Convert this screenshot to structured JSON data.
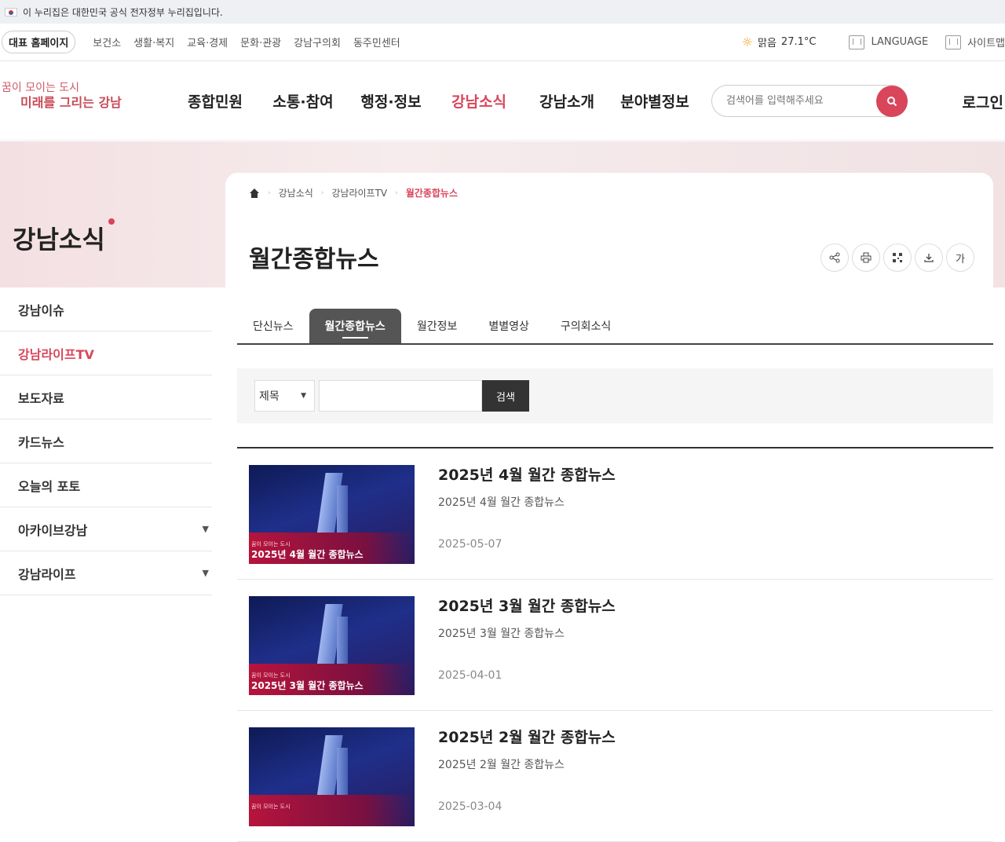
{
  "gov_banner": {
    "text": "이 누리집은 대한민국 공식 전자정부 누리집입니다."
  },
  "util": {
    "home_label": "대표 홈페이지",
    "links": [
      "보건소",
      "생활·복지",
      "교육·경제",
      "문화·관광",
      "강남구의회",
      "동주민센터"
    ],
    "weather_condition": "맑음",
    "weather_temp": "27.1°C",
    "language_label": "LANGUAGE",
    "sitemap_label": "사이트맵"
  },
  "logo": {
    "line1": "꿈이 모이는 도시",
    "line2": "미래를 그리는 강남"
  },
  "gnb": {
    "items": [
      "종합민원",
      "소통·참여",
      "행정·정보",
      "강남소식",
      "강남소개",
      "분야별정보"
    ],
    "active_index": 3
  },
  "search": {
    "placeholder": "검색어를 입력해주세요"
  },
  "login_label": "로그인",
  "hero": {
    "title": "강남소식"
  },
  "breadcrumb": {
    "items": [
      "강남소식",
      "강남라이프TV",
      "월간종합뉴스"
    ]
  },
  "page": {
    "title": "월간종합뉴스"
  },
  "tools": {
    "font_label": "가"
  },
  "lnb": {
    "items": [
      {
        "label": "강남이슈",
        "active": false,
        "expandable": false
      },
      {
        "label": "강남라이프TV",
        "active": true,
        "expandable": false
      },
      {
        "label": "보도자료",
        "active": false,
        "expandable": false
      },
      {
        "label": "카드뉴스",
        "active": false,
        "expandable": false
      },
      {
        "label": "오늘의 포토",
        "active": false,
        "expandable": false
      },
      {
        "label": "아카이브강남",
        "active": false,
        "expandable": true
      },
      {
        "label": "강남라이프",
        "active": false,
        "expandable": true
      }
    ]
  },
  "tabs": {
    "items": [
      "단신뉴스",
      "월간종합뉴스",
      "월간정보",
      "별별영상",
      "구의회소식"
    ],
    "active_index": 1
  },
  "filter": {
    "select_value": "제목",
    "search_button": "검색"
  },
  "articles": [
    {
      "title": "2025년 4월 월간 종합뉴스",
      "summary": "2025년 4월 월간 종합뉴스",
      "date": "2025-05-07",
      "thumb_caption": "2025년 4월 월간 종합뉴스"
    },
    {
      "title": "2025년 3월 월간 종합뉴스",
      "summary": "2025년 3월 월간 종합뉴스",
      "date": "2025-04-01",
      "thumb_caption": "2025년 3월 월간 종합뉴스"
    },
    {
      "title": "2025년 2월 월간 종합뉴스",
      "summary": "2025년 2월 월간 종합뉴스",
      "date": "2025-03-04",
      "thumb_caption": ""
    }
  ],
  "colors": {
    "accent": "#d9455b",
    "tab_active_bg": "#555555"
  }
}
